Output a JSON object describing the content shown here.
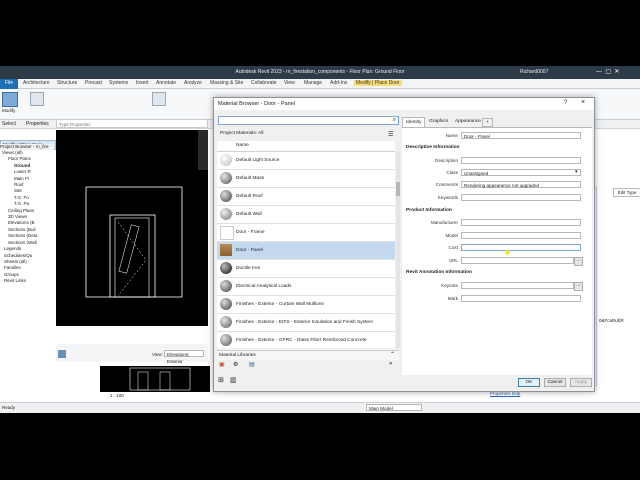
{
  "app": {
    "title": "Autodesk Revit 2023 - rn_firestation_components - Floor Plan: Ground Floor",
    "user": "Richard0007",
    "ribbon_tabs": [
      "Architecture",
      "Structure",
      "Precast",
      "Systems",
      "Insert",
      "Annotate",
      "Analyze",
      "Massing & Site",
      "Collaborate",
      "View",
      "Manage",
      "Add-Ins",
      "Modify | Place Door"
    ],
    "file_tab": "File",
    "ribbon_labels": {
      "modify": "Modify",
      "select": "Select",
      "properties": "Properties",
      "clipboard": "Clipboard"
    },
    "modify_banner": "Modify | Place Door",
    "type_properties": "Type Properties",
    "edit_type": "Edit Type",
    "view_label": "View:",
    "view_value": "Elevations: Exterior",
    "scale": "1 : 100",
    "status": "Ready",
    "main_model": "Main Model",
    "properties_help": "Properties help",
    "browser_title": "Project Browser - rn_fire",
    "tree": [
      "Views (all)",
      "Floor Plans",
      "Ground",
      "Lower R",
      "Main Fl",
      "Roof",
      "Site",
      "T.O. Fo",
      "T.O. Pa",
      "Ceiling Plans",
      "3D Views",
      "Elevations (B",
      "Sections (Buil",
      "Sections (Deta",
      "Sections (Wall",
      "Legends",
      "Schedules/Qu",
      "Sheets (all)",
      "Families",
      "Groups",
      "Revit Links"
    ],
    "right_value": "0&FcaRuf(R"
  },
  "dialog": {
    "title": "Material Browser - Door - Panel",
    "search_placeholder": "",
    "filter_label": "Project Materials: All",
    "column_name": "Name",
    "materials": [
      {
        "name": "Default Light Source",
        "color": "#cfcfcf"
      },
      {
        "name": "Default Mass",
        "color": "#9a9a9a"
      },
      {
        "name": "Default Roof",
        "color": "#8e8e8e"
      },
      {
        "name": "Default Wall",
        "color": "#b0b0b0"
      },
      {
        "name": "Door - Frame",
        "color": "#ffffff"
      },
      {
        "name": "Door - Panel",
        "color": "#a07845",
        "selected": true
      },
      {
        "name": "Ductile Iron",
        "color": "#5c5c5c"
      },
      {
        "name": "Electrical Analytical Loads",
        "color": "#8b8b8b"
      },
      {
        "name": "Finishes - Exterior - Curtain Wall Mullions",
        "color": "#8a8a8a"
      },
      {
        "name": "Finishes - Exterior - EIFS - Exterior Insulation and Finish System",
        "color": "#a3a3a3"
      },
      {
        "name": "Finishes - Exterior - GFRC - Glass Fiber Reinforced Concrete",
        "color": "#9c9c9c"
      }
    ],
    "libraries_label": "Material Libraries",
    "tabs": [
      "Identity",
      "Graphics",
      "Appearance",
      "+"
    ],
    "identity": {
      "name_label": "Name",
      "name_value": "Door - Panel",
      "descriptive_header": "Descriptive Information",
      "description_label": "Description",
      "class_label": "Class",
      "class_value": "Unassigned",
      "comments_label": "Comments",
      "comments_value": "Rendering appearance not upgraded",
      "keywords_label": "Keywords",
      "product_header": "Product Information",
      "manufacturer_label": "Manufacturer",
      "model_label": "Model",
      "cost_label": "Cost",
      "url_label": "URL",
      "annotation_header": "Revit Annotation Information",
      "keynote_label": "Keynote",
      "mark_label": "Mark"
    },
    "buttons": {
      "ok": "OK",
      "cancel": "Cancel",
      "apply": "Apply"
    },
    "help": "?",
    "close": "×"
  }
}
